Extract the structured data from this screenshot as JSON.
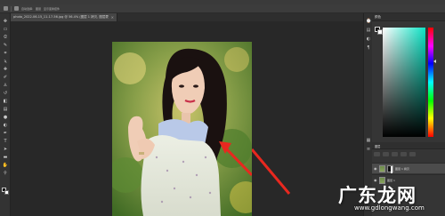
{
  "app": {
    "title": "Photoshop"
  },
  "options_bar": {
    "labels": [
      "自动选择:",
      "图层",
      "显示变换控件"
    ]
  },
  "document": {
    "tab_title": "photo_2022-06-15_11-17-56.jpg @ 56.4% (图层 1 拷贝, 图层蒙版/8) *",
    "close_glyph": "×"
  },
  "panels": {
    "color_tab": "颜色",
    "layers_tab": "图层",
    "layers": [
      {
        "name": "图层 1 拷贝",
        "selected": true
      },
      {
        "name": "图层 1",
        "selected": false
      }
    ]
  },
  "colors": {
    "foreground": "#000000",
    "background": "#ffffff",
    "picker_hue": "#0de3c5",
    "arrow": "#e8281f"
  },
  "icons": [
    "move-icon",
    "marquee-icon",
    "lasso-icon",
    "quick-select-icon",
    "crop-icon",
    "eyedropper-icon",
    "healing-icon",
    "brush-icon",
    "stamp-icon",
    "history-brush-icon",
    "eraser-icon",
    "gradient-icon",
    "blur-icon",
    "dodge-icon",
    "pen-icon",
    "type-icon",
    "path-select-icon",
    "shape-icon",
    "hand-icon",
    "zoom-icon"
  ],
  "watermark": {
    "text": "广东龙网",
    "url": "www.gdlongwang.com"
  }
}
